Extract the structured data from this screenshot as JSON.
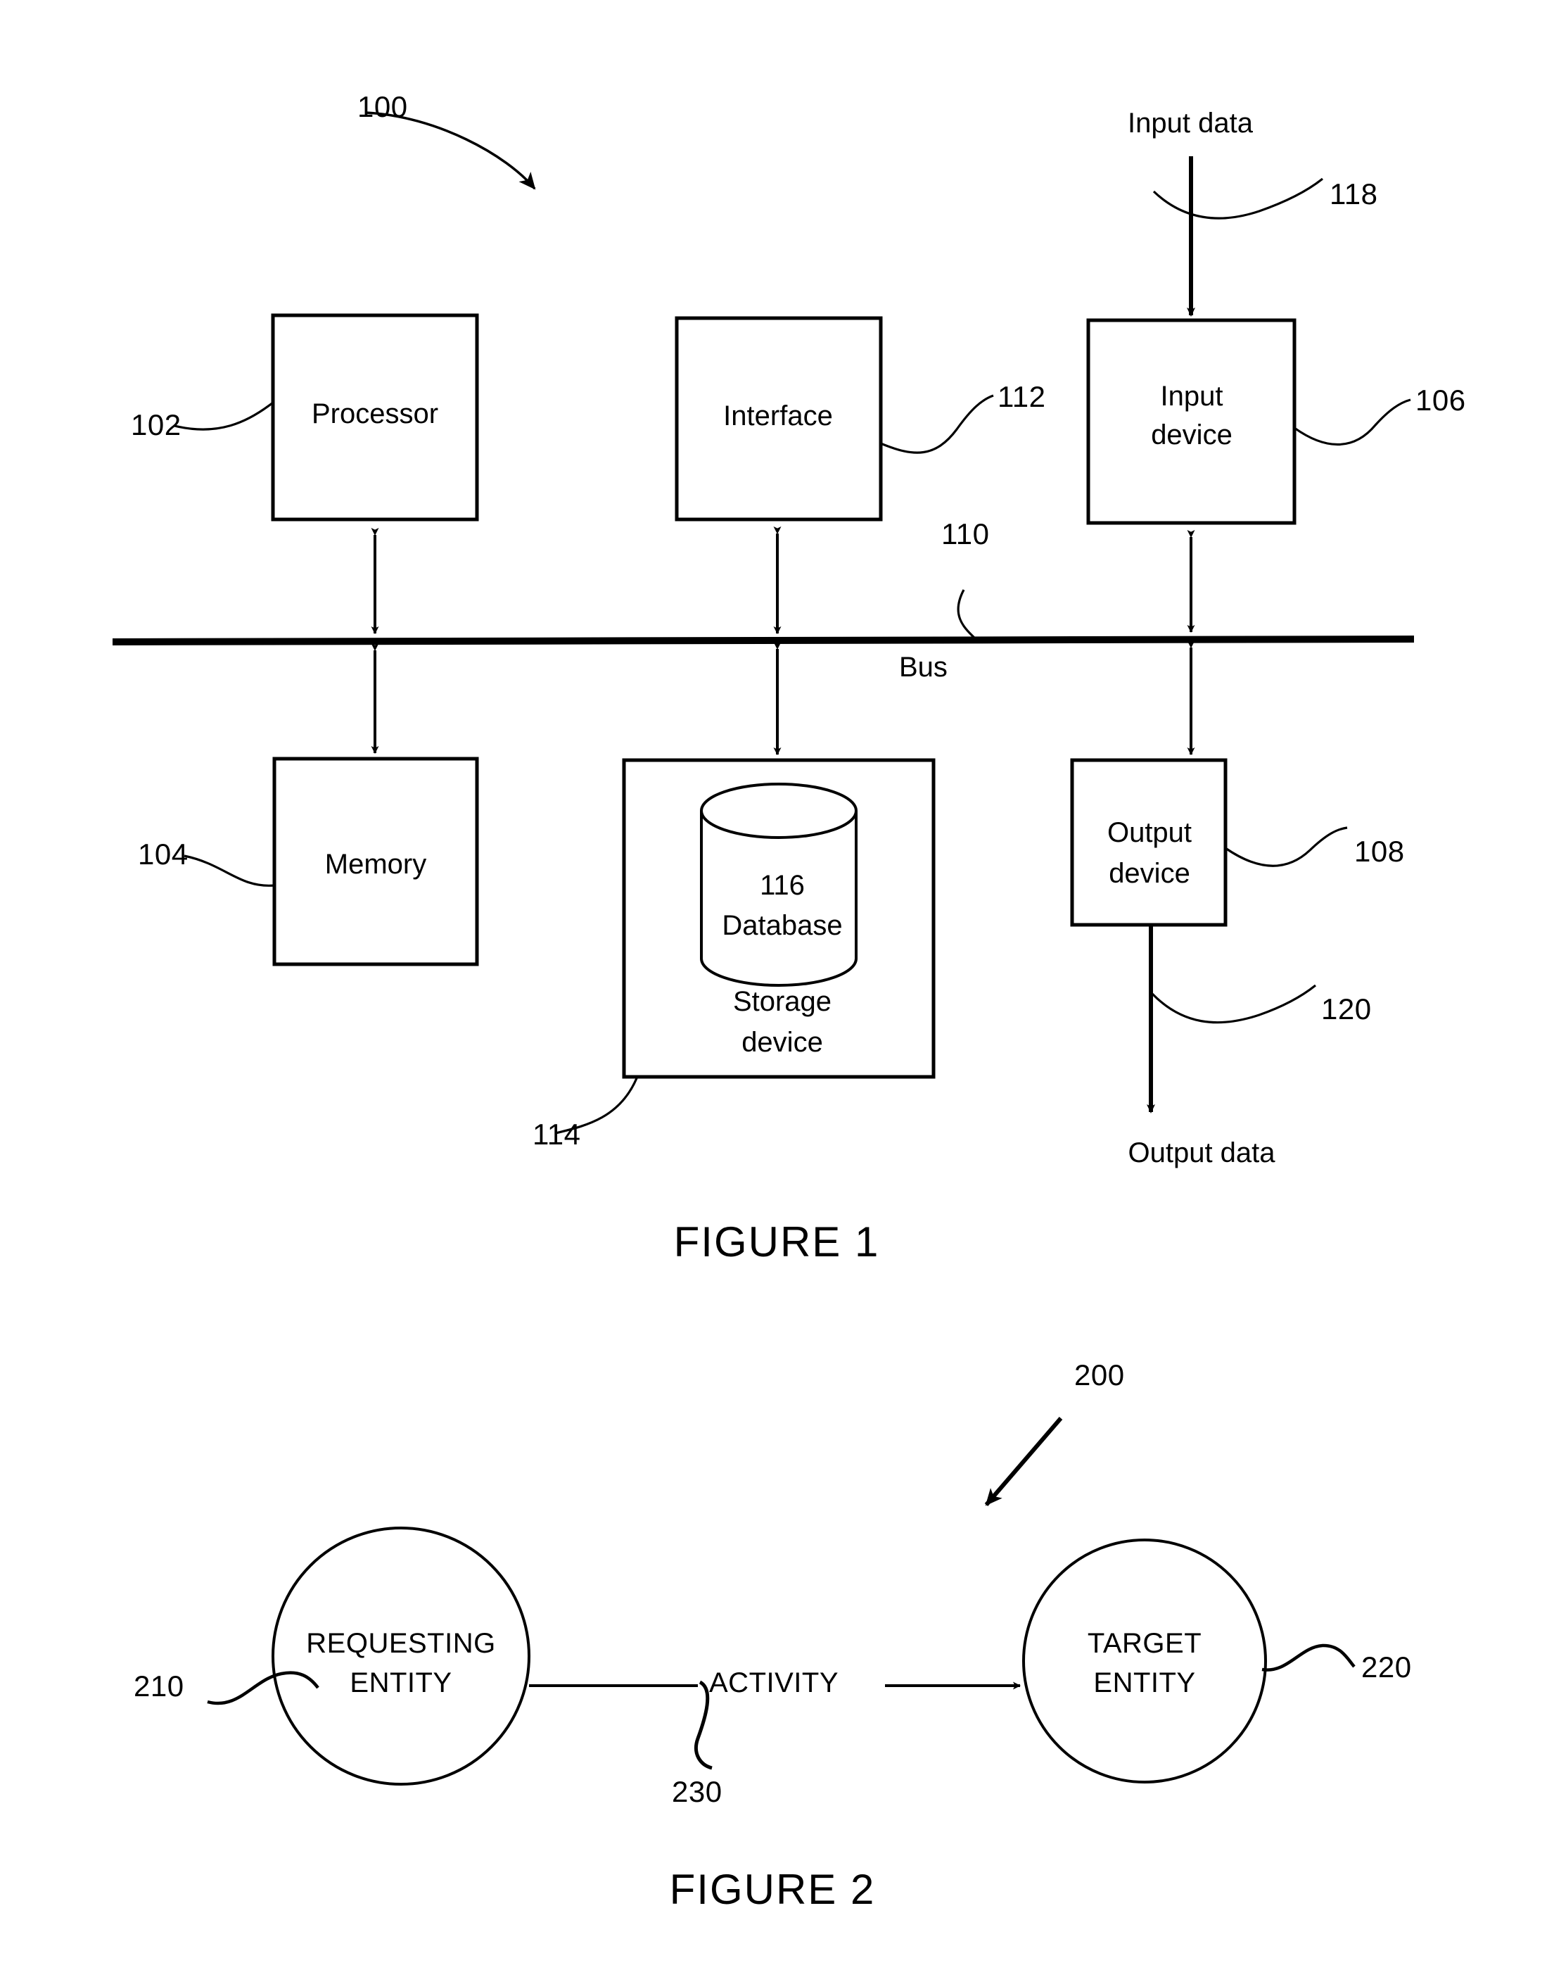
{
  "document": {
    "type": "patent-drawing-sheet",
    "figures": [
      {
        "id": "figure-1",
        "caption": "FIGURE 1",
        "system_ref": "100",
        "blocks": [
          {
            "ref": "102",
            "label": "Processor"
          },
          {
            "ref": "112",
            "label": "Interface"
          },
          {
            "ref": "106",
            "label": "Input\ndevice"
          },
          {
            "ref": "104",
            "label": "Memory"
          },
          {
            "ref": "114",
            "label": "Storage\ndevice"
          },
          {
            "ref": "116",
            "label": "116\nDatabase"
          },
          {
            "ref": "108",
            "label": "Output\ndevice"
          }
        ],
        "bus": {
          "ref": "110",
          "label": "Bus"
        },
        "io": [
          {
            "ref": "118",
            "label": "Input data"
          },
          {
            "ref": "120",
            "label": "Output data"
          }
        ]
      },
      {
        "id": "figure-2",
        "caption": "FIGURE 2",
        "system_ref": "200",
        "nodes": [
          {
            "ref": "210",
            "label": "REQUESTING\nENTITY"
          },
          {
            "ref": "220",
            "label": "TARGET\nENTITY"
          }
        ],
        "edge": {
          "ref": "230",
          "label": "ACTIVITY"
        }
      }
    ]
  },
  "fig1": {
    "ref_100": "100",
    "ref_102": "102",
    "ref_104": "104",
    "ref_106": "106",
    "ref_108": "108",
    "ref_110": "110",
    "ref_112": "112",
    "ref_114": "114",
    "ref_118": "118",
    "ref_120": "120",
    "processor_label": "Processor",
    "interface_label": "Interface",
    "input_device_line1": "Input",
    "input_device_line2": "device",
    "memory_label": "Memory",
    "storage_line1": "Storage",
    "storage_line2": "device",
    "database_line1": "116",
    "database_line2": "Database",
    "output_device_line1": "Output",
    "output_device_line2": "device",
    "bus_label": "Bus",
    "input_data_label": "Input data",
    "output_data_label": "Output data",
    "caption": "FIGURE 1"
  },
  "fig2": {
    "ref_200": "200",
    "ref_210": "210",
    "ref_220": "220",
    "ref_230": "230",
    "requesting_line1": "REQUESTING",
    "requesting_line2": "ENTITY",
    "target_line1": "TARGET",
    "target_line2": "ENTITY",
    "activity_label": "ACTIVITY",
    "caption": "FIGURE 2"
  },
  "colors": {
    "ink": "#000000",
    "paper": "#ffffff"
  }
}
